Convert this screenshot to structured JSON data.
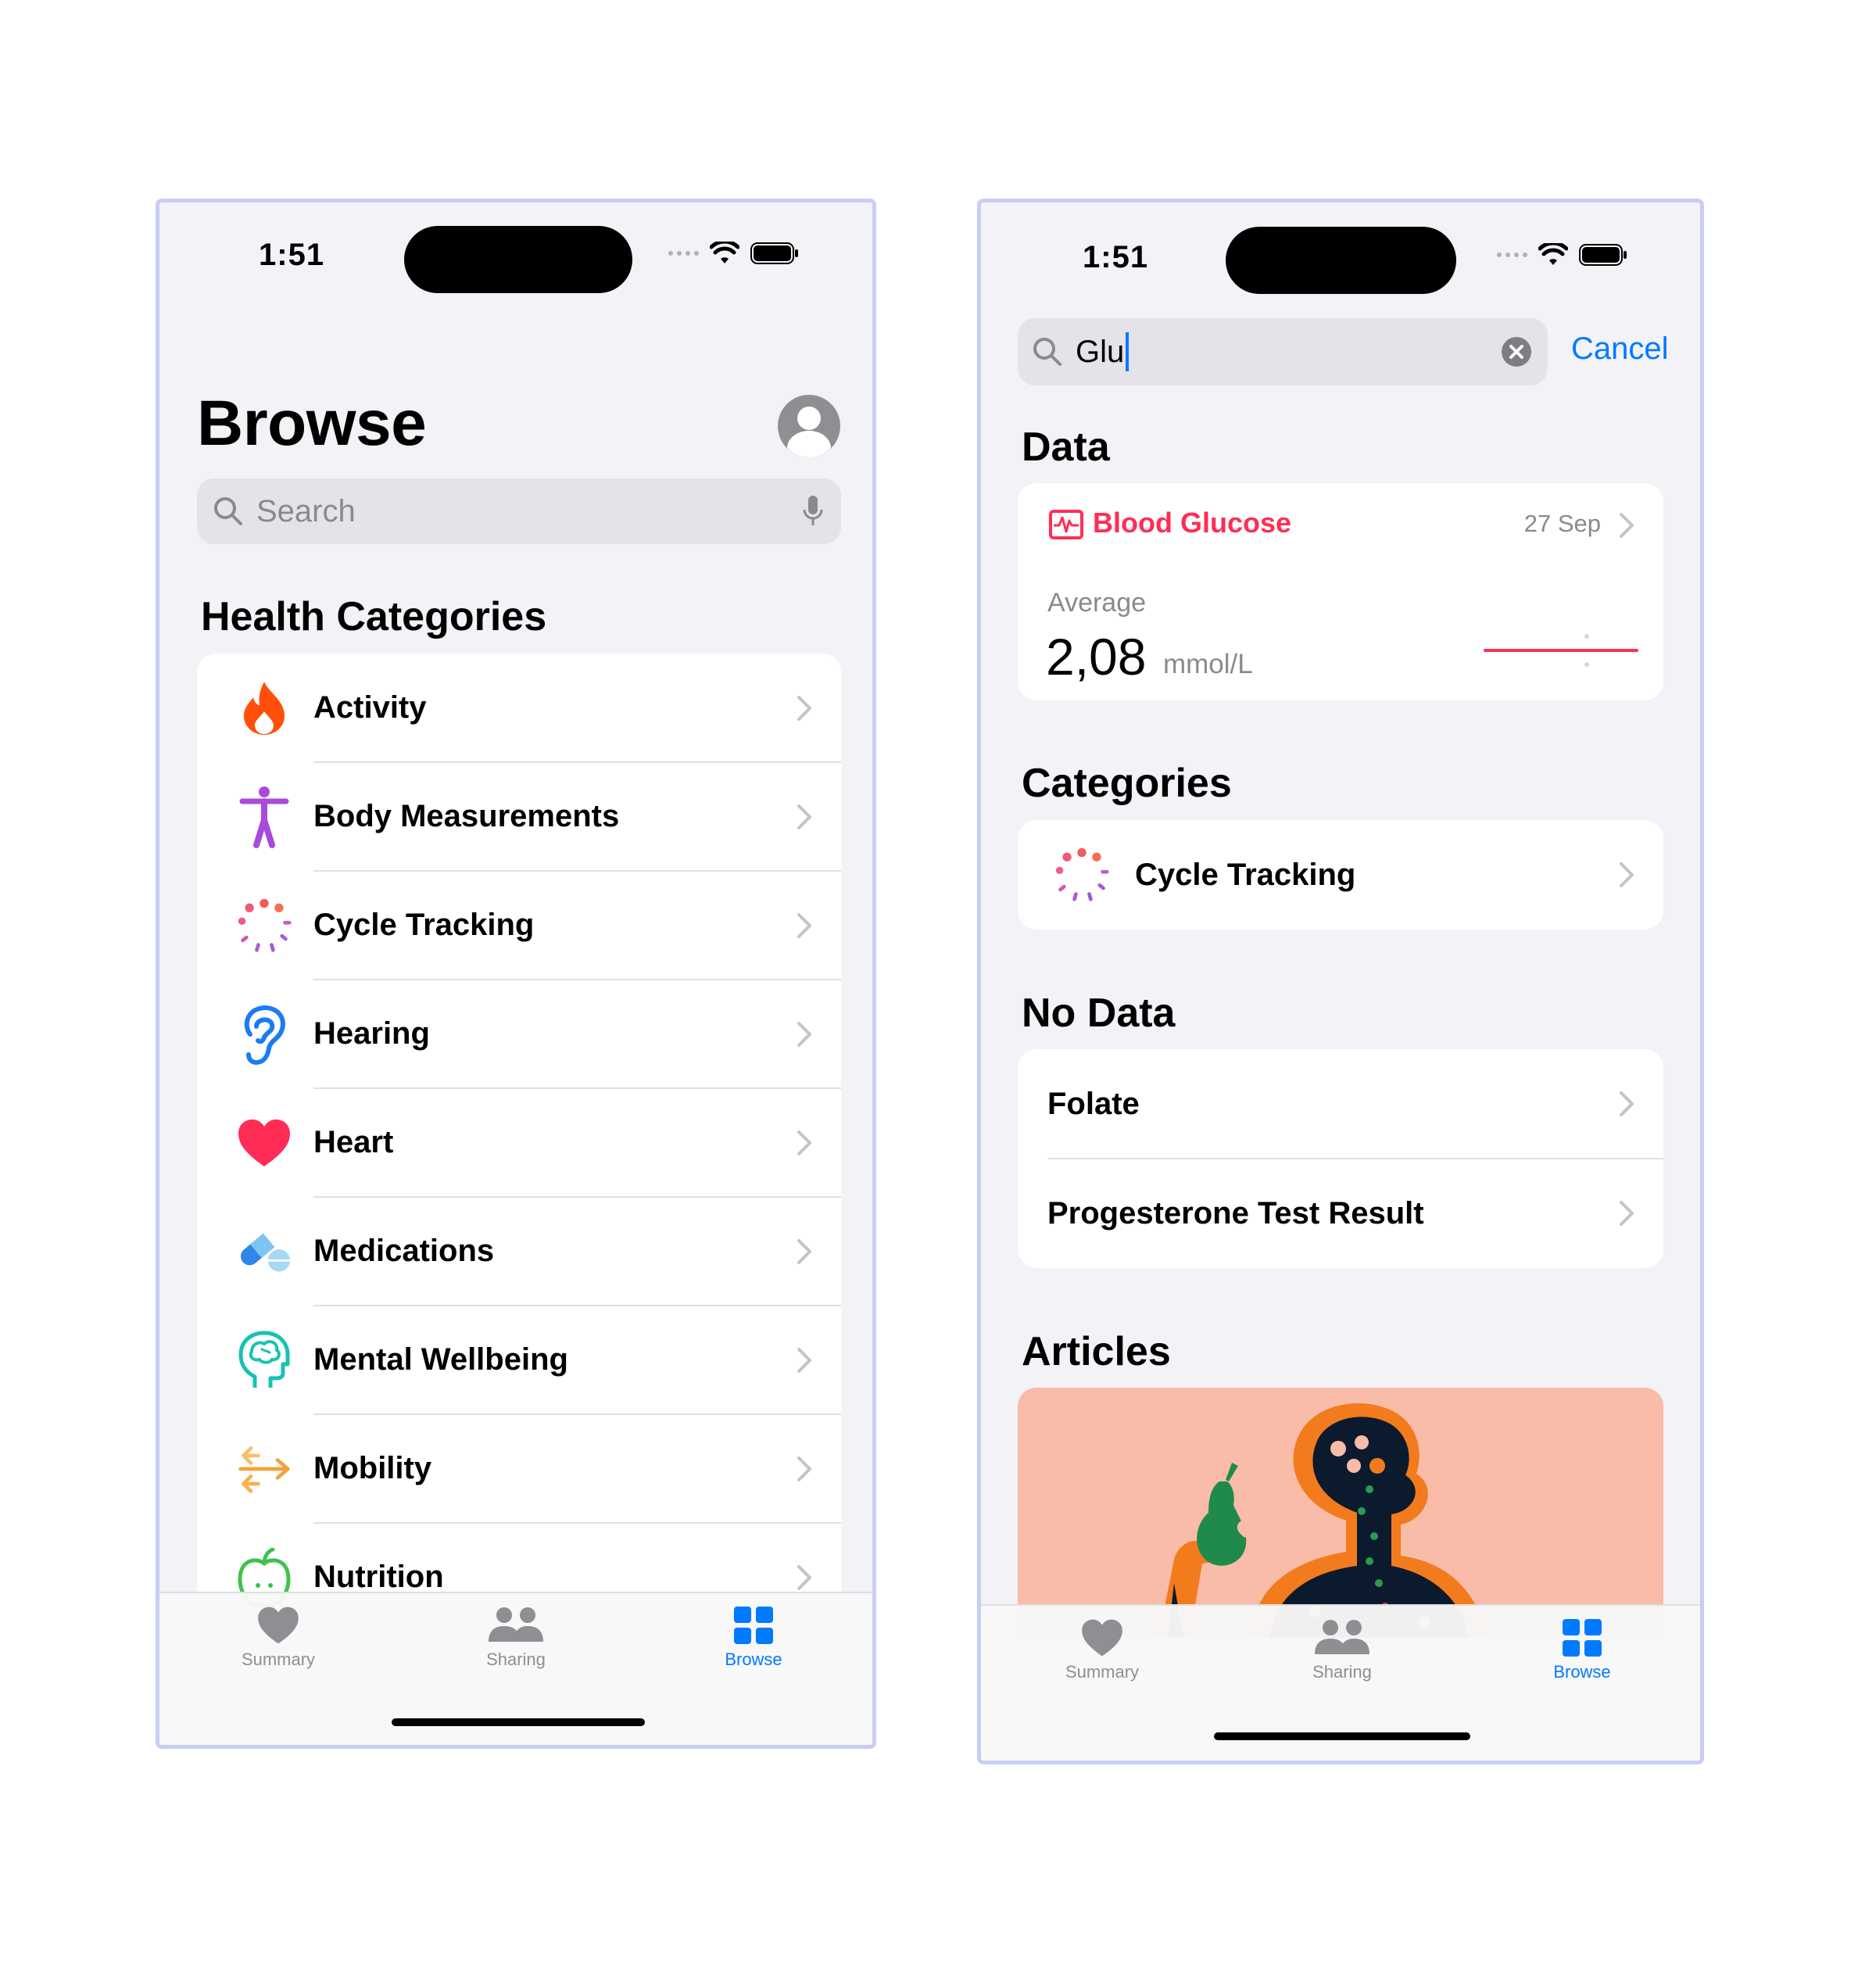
{
  "left": {
    "status": {
      "time": "1:51"
    },
    "title": "Browse",
    "search": {
      "placeholder": "Search"
    },
    "section_title": "Health Categories",
    "categories": [
      {
        "label": "Activity",
        "icon": "flame-icon"
      },
      {
        "label": "Body Measurements",
        "icon": "figure-icon"
      },
      {
        "label": "Cycle Tracking",
        "icon": "cycle-tracking-icon"
      },
      {
        "label": "Hearing",
        "icon": "ear-icon"
      },
      {
        "label": "Heart",
        "icon": "heart-icon"
      },
      {
        "label": "Medications",
        "icon": "pills-icon"
      },
      {
        "label": "Mental Wellbeing",
        "icon": "brain-head-icon"
      },
      {
        "label": "Mobility",
        "icon": "arrows-icon"
      },
      {
        "label": "Nutrition",
        "icon": "apple-icon"
      }
    ],
    "tabs": [
      {
        "label": "Summary",
        "icon": "heart-icon"
      },
      {
        "label": "Sharing",
        "icon": "people-icon"
      },
      {
        "label": "Browse",
        "icon": "grid-icon",
        "active": true
      }
    ]
  },
  "right": {
    "status": {
      "time": "1:51"
    },
    "search": {
      "value": "Glu",
      "cancel": "Cancel"
    },
    "data_title": "Data",
    "data_card": {
      "name": "Blood Glucose",
      "date": "27 Sep",
      "stat_label": "Average",
      "value": "2,08",
      "unit": "mmol/L"
    },
    "categories_title": "Categories",
    "category_item": "Cycle Tracking",
    "nodata_title": "No Data",
    "nodata_items": [
      "Folate",
      "Progesterone Test Result"
    ],
    "articles_title": "Articles",
    "tabs": [
      {
        "label": "Summary",
        "icon": "heart-icon"
      },
      {
        "label": "Sharing",
        "icon": "people-icon"
      },
      {
        "label": "Browse",
        "icon": "grid-icon",
        "active": true
      }
    ]
  },
  "colors": {
    "accent": "#007aff",
    "glucose": "#ff2d55",
    "background": "#f2f2f7",
    "article_bg": "#f9bca8"
  }
}
